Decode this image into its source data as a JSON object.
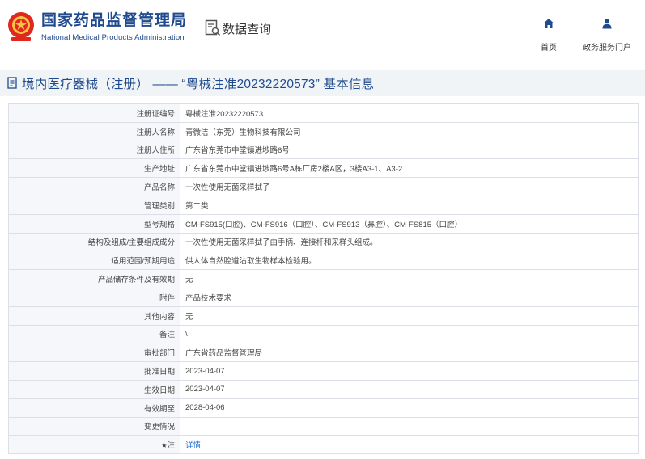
{
  "header": {
    "logo_cn": "国家药品监督管理局",
    "logo_en": "National Medical Products Administration",
    "query_label": "数据查询",
    "nav": [
      {
        "label": "首页",
        "icon": "home-icon"
      },
      {
        "label": "政务服务门户",
        "icon": "user-icon"
      }
    ]
  },
  "title": "境内医疗器械（注册） —— “粤械注准20232220573” 基本信息",
  "rows": [
    {
      "label": "注册证编号",
      "value": "粤械注准20232220573"
    },
    {
      "label": "注册人名称",
      "value": "青微洁（东莞）生物科技有限公司"
    },
    {
      "label": "注册人住所",
      "value": "广东省东莞市中堂镇进埗路6号"
    },
    {
      "label": "生产地址",
      "value": "广东省东莞市中堂镇进埗路6号A栋厂房2楼A区，3楼A3-1、A3-2"
    },
    {
      "label": "产品名称",
      "value": "一次性使用无菌采样拭子"
    },
    {
      "label": "管理类别",
      "value": "第二类"
    },
    {
      "label": "型号规格",
      "value": "CM-FS915(口腔)、CM-FS916（口腔）、CM-FS913（鼻腔）、CM-FS815（口腔）"
    },
    {
      "label": "结构及组成/主要组成成分",
      "value": "一次性使用无菌采样拭子由手柄、连接杆和采样头组成。"
    },
    {
      "label": "适用范围/预期用途",
      "value": "供人体自然腔道沾取生物样本检验用。"
    },
    {
      "label": "产品储存条件及有效期",
      "value": "无"
    },
    {
      "label": "附件",
      "value": "产品技术要求"
    },
    {
      "label": "其他内容",
      "value": "无"
    },
    {
      "label": "备注",
      "value": "\\"
    },
    {
      "label": "审批部门",
      "value": "广东省药品监督管理局"
    },
    {
      "label": "批准日期",
      "value": "2023-04-07"
    },
    {
      "label": "生效日期",
      "value": "2023-04-07"
    },
    {
      "label": "有效期至",
      "value": "2028-04-06"
    },
    {
      "label": "变更情况",
      "value": ""
    },
    {
      "label": "注",
      "value": "详情",
      "icon": "star-icon"
    }
  ]
}
